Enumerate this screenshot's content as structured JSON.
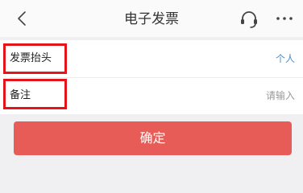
{
  "navbar": {
    "title": "电子发票",
    "back_icon": "chevron-left-icon",
    "support_icon": "headset-icon",
    "more_icon": "more-dots-icon"
  },
  "form": {
    "invoice_title": {
      "label": "发票抬头",
      "value": "个人"
    },
    "remark": {
      "label": "备注",
      "placeholder": "请输入"
    }
  },
  "actions": {
    "confirm_label": "确定"
  },
  "colors": {
    "accent": "#e85c57",
    "link": "#4a8fd0",
    "highlight": "#e4141b"
  }
}
